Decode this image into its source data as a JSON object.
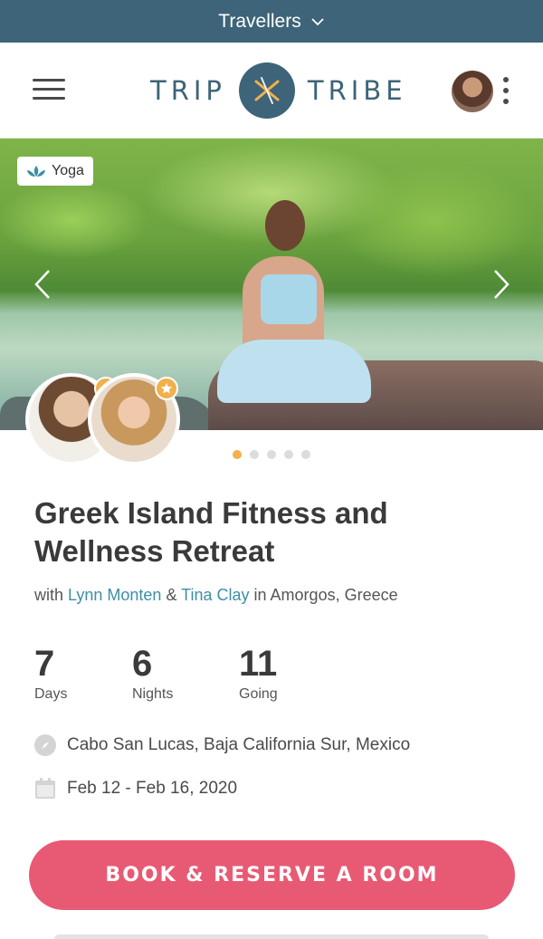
{
  "topbar": {
    "label": "Travellers"
  },
  "header": {
    "logo_left": "TRIP",
    "logo_right": "TRIBE"
  },
  "hero": {
    "tag": "Yoga",
    "slide_count": 5,
    "active_slide": 1
  },
  "retreat": {
    "title": "Greek Island Fitness and Wellness Retreat",
    "with": "with",
    "host1": "Lynn Monten",
    "amp": "&",
    "host2": "Tina Clay",
    "location_prefix": "in Amorgos, Greece"
  },
  "stats": [
    {
      "value": "7",
      "label": "Days"
    },
    {
      "value": "6",
      "label": "Nights"
    },
    {
      "value": "11",
      "label": "Going"
    }
  ],
  "details": {
    "location": "Cabo San Lucas, Baja California Sur, Mexico",
    "dates": "Feb 12 - Feb 16, 2020"
  },
  "cta": {
    "book_label": "BOOK & RESERVE A ROOM"
  },
  "colors": {
    "brand": "#3d6478",
    "accent": "#e85a74",
    "link": "#3d8fa6",
    "star": "#f2b04b"
  }
}
